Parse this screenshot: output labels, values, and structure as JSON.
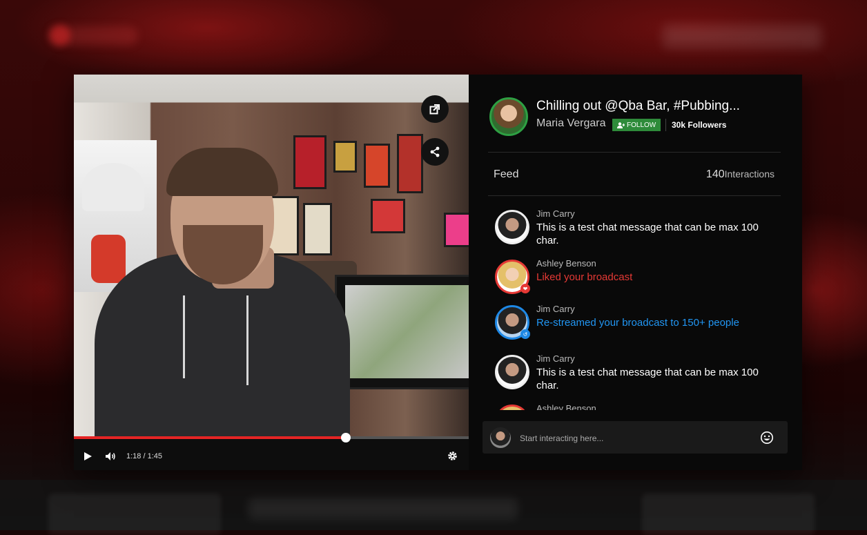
{
  "broadcast": {
    "title": "Chilling out @Qba Bar, #Pubbing...",
    "streamer": "Maria Vergara",
    "follow_label": "FOLLOW",
    "followers": "30k Followers"
  },
  "player": {
    "time": "1:18 / 1:45",
    "progress": 0.689
  },
  "feed": {
    "label": "Feed",
    "interactions_count": "140",
    "interactions_label": "Interactions",
    "items": [
      {
        "name": "Jim Carry",
        "message": "This is a test chat message that can be max 100 char.",
        "type": "chat"
      },
      {
        "name": "Ashley Benson",
        "message": "Liked your broadcast",
        "type": "like"
      },
      {
        "name": "Jim Carry",
        "message": "Re-streamed your broadcast to 150+ people",
        "type": "restream"
      },
      {
        "name": "Jim Carry",
        "message": "This is a test chat message that can be max 100 char.",
        "type": "chat"
      },
      {
        "name": "Ashley Benson",
        "message": "",
        "type": "like"
      }
    ]
  },
  "chat": {
    "placeholder": "Start interacting here..."
  },
  "colors": {
    "accent_red": "#e52424",
    "follow_green": "#2e8b3a",
    "like_red": "#e53935",
    "restream_blue": "#2196f3"
  },
  "icons": [
    "popout-icon",
    "share-icon",
    "play-icon",
    "volume-icon",
    "settings-icon",
    "user-plus-icon",
    "like-icon",
    "restream-icon",
    "emoji-icon"
  ]
}
